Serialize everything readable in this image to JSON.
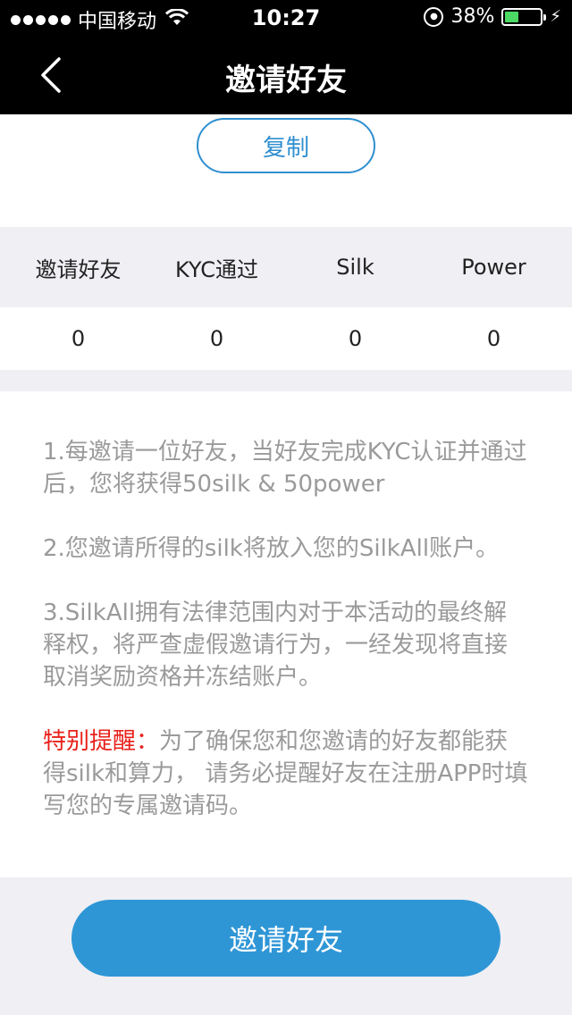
{
  "status_bar": {
    "carrier": "中国移动",
    "time": "10:27",
    "battery_percent": "38%",
    "battery_level": 0.38,
    "icons": [
      "signal-dots-icon",
      "wifi-icon",
      "rotation-lock-icon",
      "battery-icon",
      "charging-bolt-icon"
    ]
  },
  "nav": {
    "title": "邀请好友",
    "back_icon": "chevron-left-icon"
  },
  "copy": {
    "label": "复制"
  },
  "stats": {
    "headers": [
      "邀请好友",
      "KYC通过",
      "Silk",
      "Power"
    ],
    "values": [
      "0",
      "0",
      "0",
      "0"
    ]
  },
  "rules": {
    "items": [
      "1.每邀请一位好友，当好友完成KYC认证并通过后，您将获得50silk & 50power",
      "2.您邀请所得的silk将放入您的SilkAll账户。",
      "3.SilkAll拥有法律范围内对于本活动的最终解释权，将严查虚假邀请行为，一经发现将直接取消奖励资格并冻结账户。"
    ],
    "warning_label": "特别提醒：",
    "warning_text": "为了确保您和您邀请的好友都能获得silk和算力， 请务必提醒好友在注册APP时填写您的专属邀请码。"
  },
  "invite_button": {
    "label": "邀请好友"
  },
  "colors": {
    "accent": "#2f96d6",
    "warning": "#e8211b",
    "muted_text": "#9a9a9a",
    "battery_fill": "#4cd964"
  }
}
